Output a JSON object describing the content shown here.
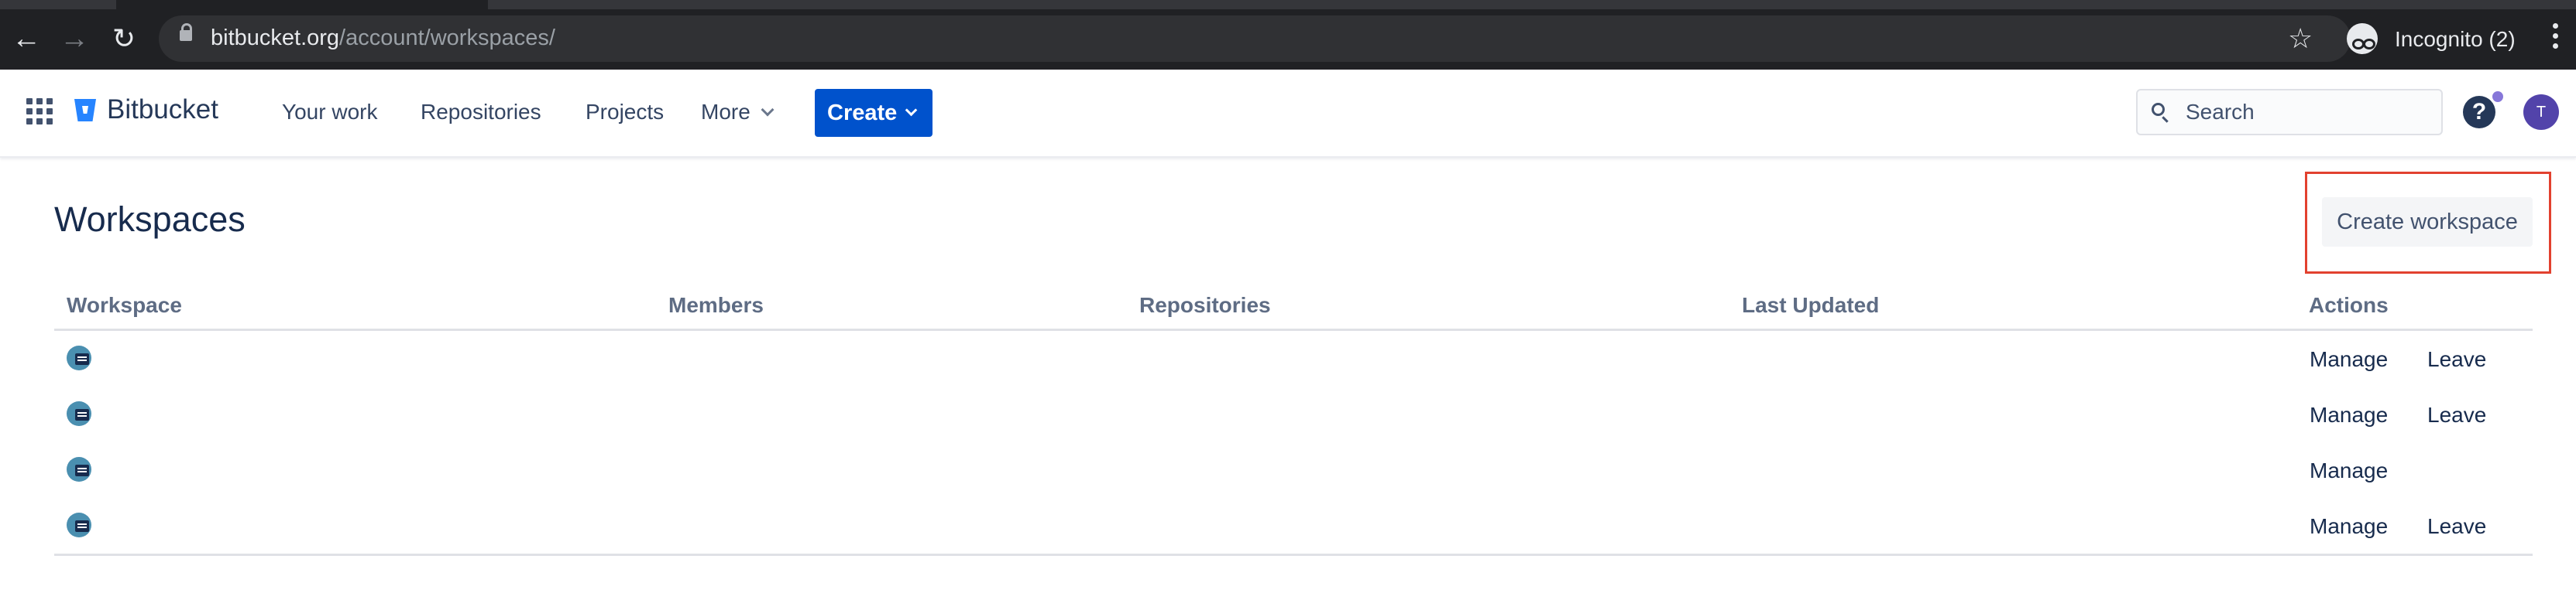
{
  "browser": {
    "url_host": "bitbucket.org",
    "url_path": "/account/workspaces/",
    "incognito_label": "Incognito (2)"
  },
  "header": {
    "product_name": "Bitbucket",
    "nav": {
      "your_work": "Your work",
      "repositories": "Repositories",
      "projects": "Projects",
      "more": "More"
    },
    "create_label": "Create",
    "search_placeholder": "Search",
    "help_glyph": "?",
    "avatar_initial": "T",
    "colors": {
      "primary": "#0052cc",
      "avatar": "#5243aa"
    }
  },
  "main": {
    "title": "Workspaces",
    "create_workspace_label": "Create workspace",
    "table": {
      "headers": {
        "workspace": "Workspace",
        "members": "Members",
        "repositories": "Repositories",
        "last_updated": "Last Updated",
        "actions": "Actions"
      },
      "rows": [
        {
          "manage": "Manage",
          "leave": "Leave"
        },
        {
          "manage": "Manage",
          "leave": "Leave"
        },
        {
          "manage": "Manage",
          "leave": ""
        },
        {
          "manage": "Manage",
          "leave": "Leave"
        }
      ]
    }
  }
}
